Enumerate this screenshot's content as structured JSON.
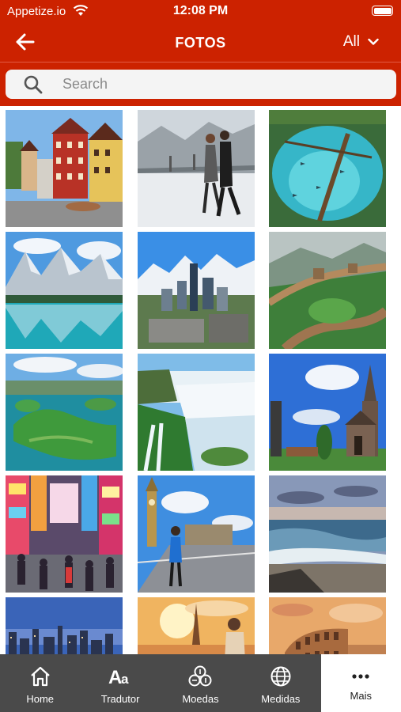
{
  "status_bar": {
    "carrier": "Appetize.io",
    "time": "12:08 PM"
  },
  "header": {
    "title": "FOTOS",
    "filter_label": "All"
  },
  "search": {
    "placeholder": "Search",
    "value": ""
  },
  "photos": [
    {
      "subject": "Half-timbered houses in a village square"
    },
    {
      "subject": "Tango dancers by a bridge"
    },
    {
      "subject": "Turquoise spring with fish"
    },
    {
      "subject": "Snowy mountains reflected in a lake"
    },
    {
      "subject": "City skyline with mountains"
    },
    {
      "subject": "Great Wall on green hills"
    },
    {
      "subject": "Lake with green islands"
    },
    {
      "subject": "Waterfalls in a jungle"
    },
    {
      "subject": "Wooden church under blue sky"
    },
    {
      "subject": "Neon-lit shopping street"
    },
    {
      "subject": "Big Ben and bridge with traveler"
    },
    {
      "subject": "Beach with waves at dusk"
    },
    {
      "subject": "City skyline at dusk"
    },
    {
      "subject": "Eiffel Tower and photographer at sunset"
    },
    {
      "subject": "Colosseum at sunset"
    }
  ],
  "tabs": [
    {
      "label": "Home",
      "icon": "home-icon"
    },
    {
      "label": "Tradutor",
      "icon": "translate-icon"
    },
    {
      "label": "Moedas",
      "icon": "coins-icon"
    },
    {
      "label": "Medidas",
      "icon": "globe-icon"
    },
    {
      "label": "Mais",
      "icon": "more-icon",
      "active": true
    }
  ],
  "colors": {
    "brand_red": "#cc2200",
    "tabbar_gray": "#4a4a4a"
  }
}
